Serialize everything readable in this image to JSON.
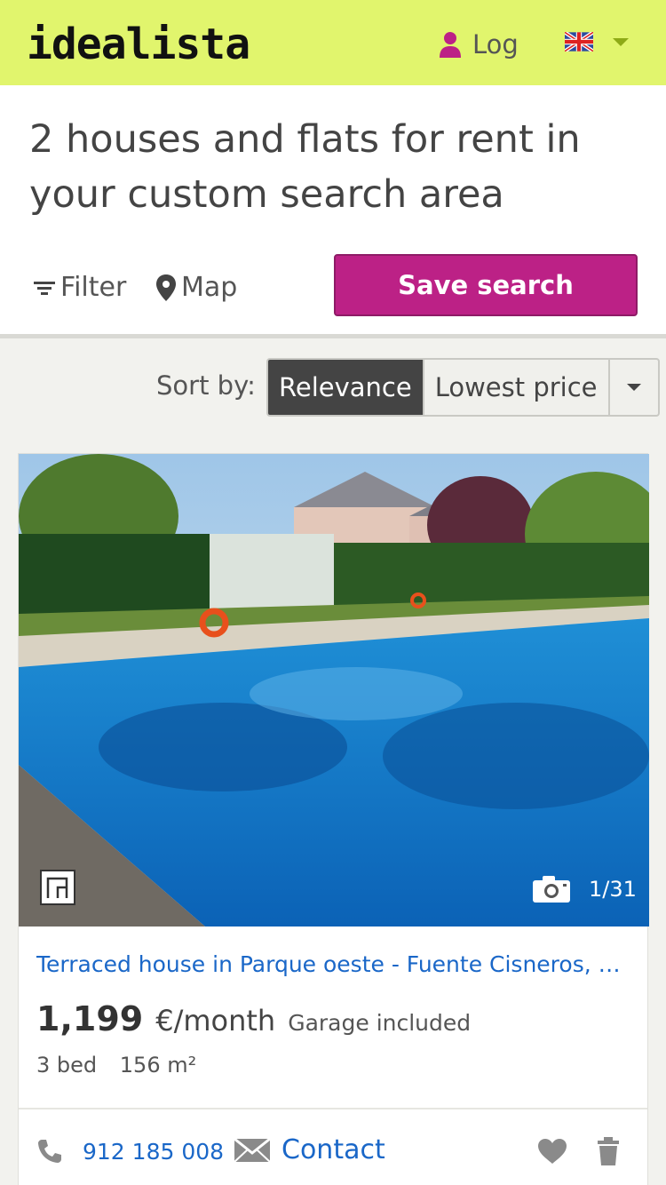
{
  "header": {
    "logo": "idealista",
    "login_label": "Log",
    "icons": {
      "user": "user-icon",
      "flag": "uk-flag-icon",
      "caret": "chevron-down-icon"
    }
  },
  "search": {
    "title": "2 houses and flats for rent in your custom search area",
    "filter_label": "Filter",
    "map_label": "Map",
    "save_label": "Save search"
  },
  "sort": {
    "label": "Sort by:",
    "options": [
      "Relevance",
      "Lowest price"
    ],
    "selected": "Relevance"
  },
  "listing": {
    "title": "Terraced house in Parque oeste - Fuente Cisneros, A...",
    "price": "1,199",
    "price_unit": "€/month",
    "extra": "Garage included",
    "bedrooms": "3 bed",
    "area": "156 m²",
    "photo_counter": "1/31",
    "phone": "912 185 008",
    "contact_label": "Contact"
  },
  "colors": {
    "header_bg": "#e1f56d",
    "save_button": "#bc2186",
    "link": "#1a67c8",
    "active_sort": "#444444"
  }
}
